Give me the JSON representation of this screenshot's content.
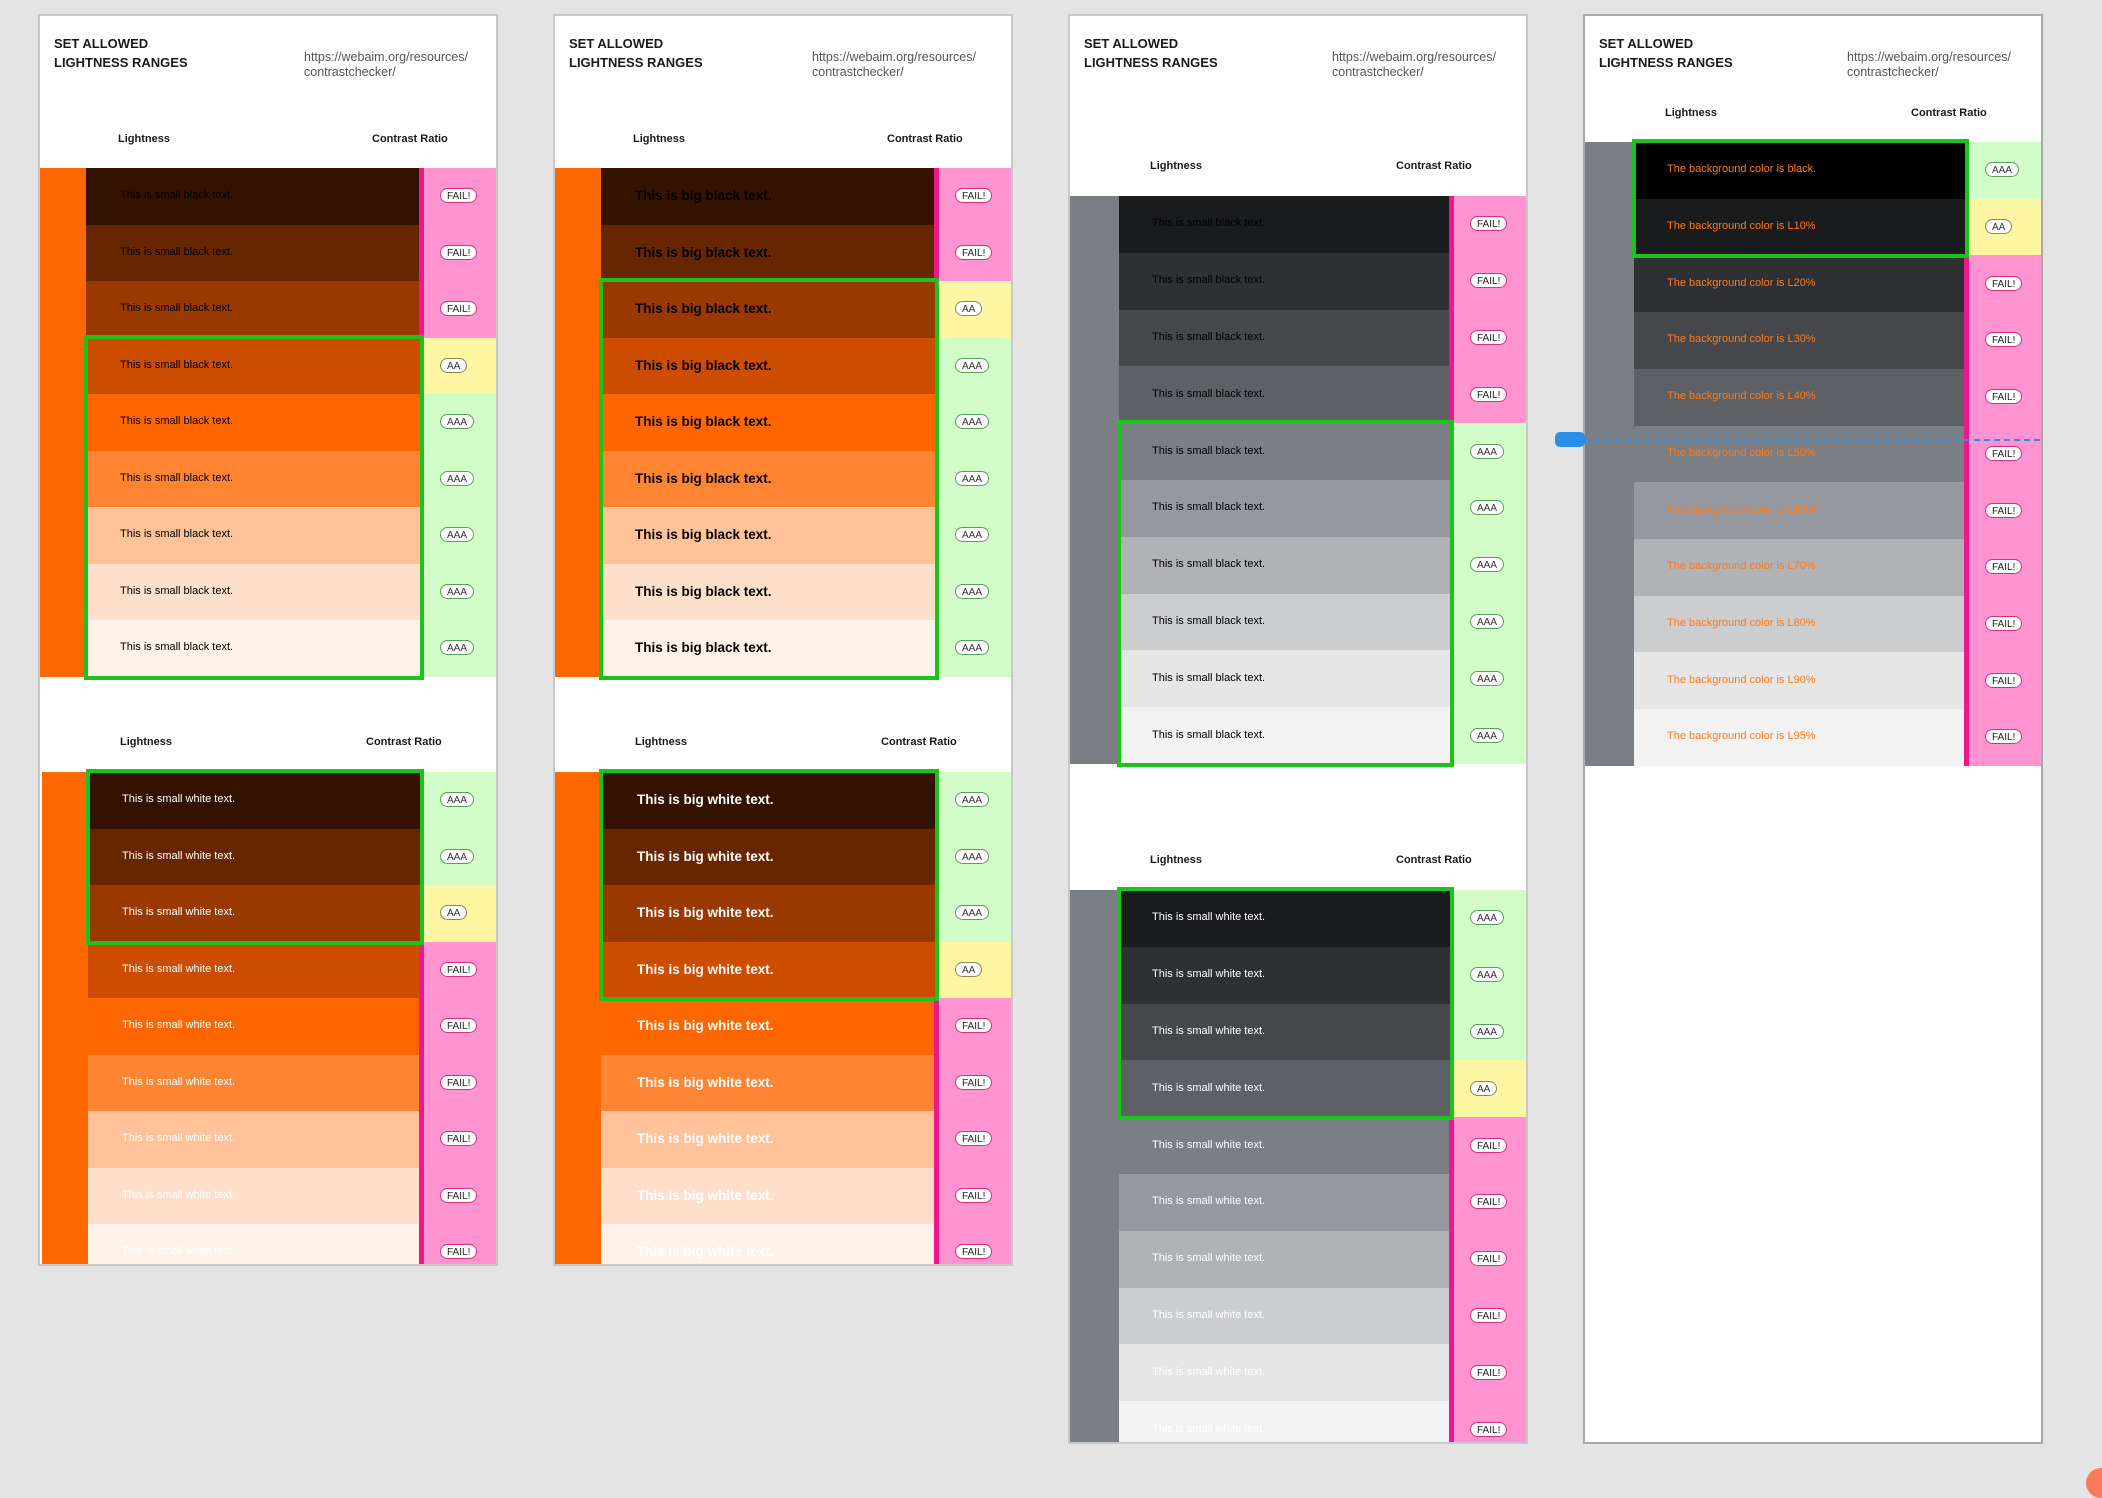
{
  "colors": {
    "orange_bar": "#ff6800",
    "gray_bar": "#7a7e85",
    "fail_bg": "#ff94d0",
    "fail_edge": "#f0168c",
    "aa_bg": "#fdf7a4",
    "aaa_bg": "#d2fdc9",
    "highlight": "#1dc31d",
    "orange_text": "#ff7a1a",
    "guide": "#2b8ee8"
  },
  "shade_names": [
    "black",
    "L10%",
    "L20%",
    "L30%",
    "L40%",
    "L50%",
    "L60%",
    "L70%",
    "L80%",
    "L90%",
    "L95%"
  ],
  "panels": [
    {
      "title": "SET ALLOWED\nLIGHTNESS RANGES",
      "url": "https://webaim.org/resources/\ncontrastchecker/",
      "sections": [
        {
          "lightness_header": "Lightness",
          "contrast_header": "Contrast Ratio",
          "rows": [
            {
              "text": "This is small black text.",
              "result": "FAIL!"
            },
            {
              "text": "This is small black text.",
              "result": "FAIL!"
            },
            {
              "text": "This is small black text.",
              "result": "FAIL!"
            },
            {
              "text": "This is small black text.",
              "result": "AA"
            },
            {
              "text": "This is small black text.",
              "result": "AAA"
            },
            {
              "text": "This is small black text.",
              "result": "AAA"
            },
            {
              "text": "This is small black text.",
              "result": "AAA"
            },
            {
              "text": "This is small black text.",
              "result": "AAA"
            },
            {
              "text": "This is small black text.",
              "result": "AAA"
            }
          ]
        },
        {
          "lightness_header": "Lightness",
          "contrast_header": "Contrast Ratio",
          "rows": [
            {
              "text": "This is small white text.",
              "result": "AAA"
            },
            {
              "text": "This is small white text.",
              "result": "AAA"
            },
            {
              "text": "This is small white text.",
              "result": "AA"
            },
            {
              "text": "This is small white text.",
              "result": "FAIL!"
            },
            {
              "text": "This is small white text.",
              "result": "FAIL!"
            },
            {
              "text": "This is small white text.",
              "result": "FAIL!"
            },
            {
              "text": "This is small white text.",
              "result": "FAIL!"
            },
            {
              "text": "This is small white text.",
              "result": "FAIL!"
            },
            {
              "text": "This is small white text.",
              "result": "FAIL!"
            }
          ]
        }
      ]
    },
    {
      "title": "SET ALLOWED\nLIGHTNESS RANGES",
      "url": "https://webaim.org/resources/\ncontrastchecker/",
      "sections": [
        {
          "lightness_header": "Lightness",
          "contrast_header": "Contrast Ratio",
          "rows": [
            {
              "text": "This is big black text.",
              "result": "FAIL!"
            },
            {
              "text": "This is big black text.",
              "result": "FAIL!"
            },
            {
              "text": "This is big black text.",
              "result": "AA"
            },
            {
              "text": "This is big black text.",
              "result": "AAA"
            },
            {
              "text": "This is big black text.",
              "result": "AAA"
            },
            {
              "text": "This is big black text.",
              "result": "AAA"
            },
            {
              "text": "This is big black text.",
              "result": "AAA"
            },
            {
              "text": "This is big black text.",
              "result": "AAA"
            },
            {
              "text": "This is big black text.",
              "result": "AAA"
            }
          ]
        },
        {
          "lightness_header": "Lightness",
          "contrast_header": "Contrast Ratio",
          "rows": [
            {
              "text": "This is big white text.",
              "result": "AAA"
            },
            {
              "text": "This is big white text.",
              "result": "AAA"
            },
            {
              "text": "This is big white text.",
              "result": "AAA"
            },
            {
              "text": "This is big white text.",
              "result": "AA"
            },
            {
              "text": "This is big white text.",
              "result": "FAIL!"
            },
            {
              "text": "This is big white text.",
              "result": "FAIL!"
            },
            {
              "text": "This is big white text.",
              "result": "FAIL!"
            },
            {
              "text": "This is big white text.",
              "result": "FAIL!"
            },
            {
              "text": "This is big white text.",
              "result": "FAIL!"
            }
          ]
        }
      ]
    },
    {
      "title": "SET ALLOWED\nLIGHTNESS RANGES",
      "url": "https://webaim.org/resources/\ncontrastchecker/",
      "sections": [
        {
          "lightness_header": "Lightness",
          "contrast_header": "Contrast Ratio",
          "rows": [
            {
              "text": "This is small black text.",
              "result": "FAIL!"
            },
            {
              "text": "This is small black text.",
              "result": "FAIL!"
            },
            {
              "text": "This is small black text.",
              "result": "FAIL!"
            },
            {
              "text": "This is small black text.",
              "result": "FAIL!"
            },
            {
              "text": "This is small black text.",
              "result": "AAA"
            },
            {
              "text": "This is small black text.",
              "result": "AAA"
            },
            {
              "text": "This is small black text.",
              "result": "AAA"
            },
            {
              "text": "This is small black text.",
              "result": "AAA"
            },
            {
              "text": "This is small black text.",
              "result": "AAA"
            },
            {
              "text": "This is small black text.",
              "result": "AAA"
            }
          ]
        },
        {
          "lightness_header": "Lightness",
          "contrast_header": "Contrast Ratio",
          "rows": [
            {
              "text": "This is small white text.",
              "result": "AAA"
            },
            {
              "text": "This is small white text.",
              "result": "AAA"
            },
            {
              "text": "This is small white text.",
              "result": "AAA"
            },
            {
              "text": "This is small white text.",
              "result": "AA"
            },
            {
              "text": "This is small white text.",
              "result": "FAIL!"
            },
            {
              "text": "This is small white text.",
              "result": "FAIL!"
            },
            {
              "text": "This is small white text.",
              "result": "FAIL!"
            },
            {
              "text": "This is small white text.",
              "result": "FAIL!"
            },
            {
              "text": "This is small white text.",
              "result": "FAIL!"
            },
            {
              "text": "This is small white text.",
              "result": "FAIL!"
            }
          ]
        }
      ]
    },
    {
      "title": "SET ALLOWED\nLIGHTNESS RANGES",
      "url": "https://webaim.org/resources/\ncontrastchecker/",
      "sections": [
        {
          "lightness_header": "Lightness",
          "contrast_header": "Contrast Ratio",
          "rows": [
            {
              "text": "The background color is black.",
              "result": "AAA"
            },
            {
              "text": "The background color is L10%",
              "result": "AA"
            },
            {
              "text": "The background color is L20%",
              "result": "FAIL!"
            },
            {
              "text": "The background color is L30%",
              "result": "FAIL!"
            },
            {
              "text": "The background color is L40%",
              "result": "FAIL!"
            },
            {
              "text": "The background color is L50%",
              "result": "FAIL!"
            },
            {
              "text": "The background color is L60%",
              "result": "FAIL!"
            },
            {
              "text": "The background color is L70%",
              "result": "FAIL!"
            },
            {
              "text": "The background color is L80%",
              "result": "FAIL!"
            },
            {
              "text": "The background color is L90%",
              "result": "FAIL!"
            },
            {
              "text": "The background color is L95%",
              "result": "FAIL!"
            }
          ]
        }
      ]
    }
  ]
}
